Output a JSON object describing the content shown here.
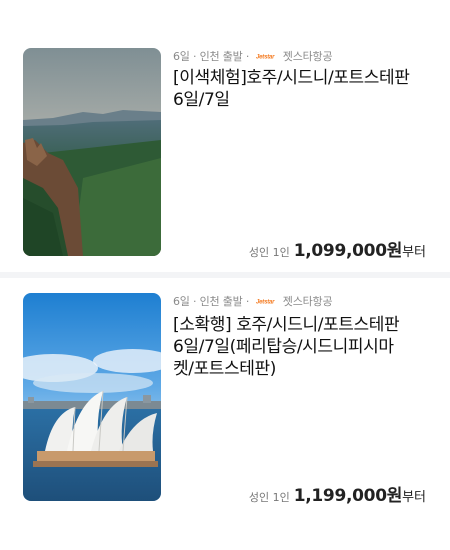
{
  "products": [
    {
      "duration": "6일",
      "departure": "인천 출발",
      "airline_logo": "jetstar-logo",
      "airline": "젯스타항공",
      "title_lines": [
        "[이색체험]호주/시드니/포트스테판",
        "6일/7일"
      ],
      "price_label": "성인 1인",
      "price": "1,099,000원",
      "price_suffix": "부터",
      "image": "blue-mountains-photo"
    },
    {
      "duration": "6일",
      "departure": "인천 출발",
      "airline_logo": "jetstar-logo",
      "airline": "젯스타항공",
      "title_lines": [
        "[소확행] 호주/시드니/포트스테판",
        "6일/7일(페리탑승/시드니피시마",
        "켓/포트스테판)"
      ],
      "price_label": "성인 1인",
      "price": "1,199,000원",
      "price_suffix": "부터",
      "image": "sydney-opera-house-photo"
    }
  ],
  "colors": {
    "meta_text": "#8a8a8a",
    "title_text": "#111111",
    "divider": "#f3f4f6",
    "jetstar_orange": "#f47a20"
  }
}
